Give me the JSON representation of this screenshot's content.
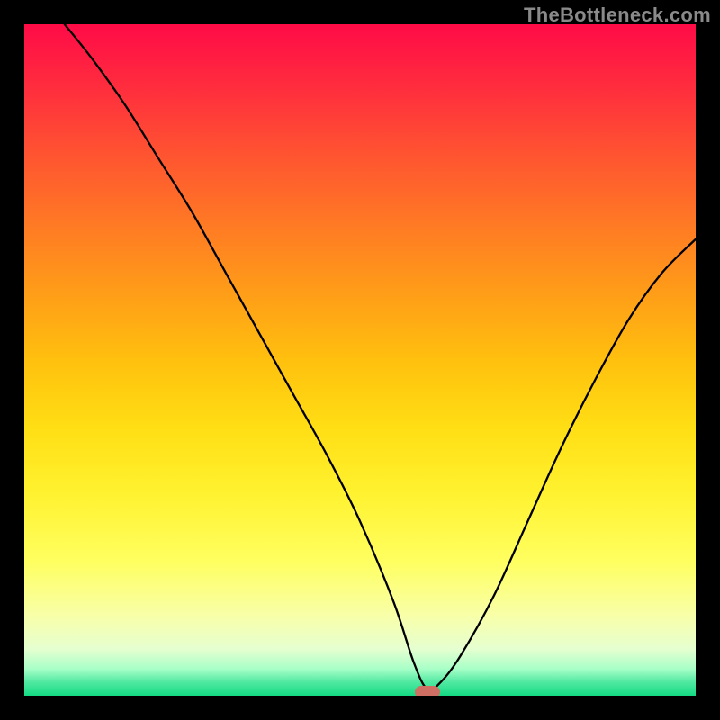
{
  "attribution": "TheBottleneck.com",
  "chart_data": {
    "type": "line",
    "title": "",
    "xlabel": "",
    "ylabel": "",
    "xlim": [
      0,
      100
    ],
    "ylim": [
      0,
      100
    ],
    "grid": false,
    "legend": false,
    "background": "rainbow-gradient",
    "x": [
      6,
      10,
      15,
      20,
      25,
      30,
      35,
      40,
      45,
      50,
      55,
      58,
      60,
      62,
      65,
      70,
      75,
      80,
      85,
      90,
      95,
      100
    ],
    "values": [
      100,
      95,
      88,
      80,
      72,
      63,
      54,
      45,
      36,
      26,
      14,
      5,
      1,
      2,
      6,
      15,
      26,
      37,
      47,
      56,
      63,
      68
    ],
    "minimum_marker": {
      "x": 60,
      "y": 0.5
    }
  },
  "colors": {
    "curve": "#000000",
    "marker": "#cf6e62",
    "frame": "#000000"
  }
}
